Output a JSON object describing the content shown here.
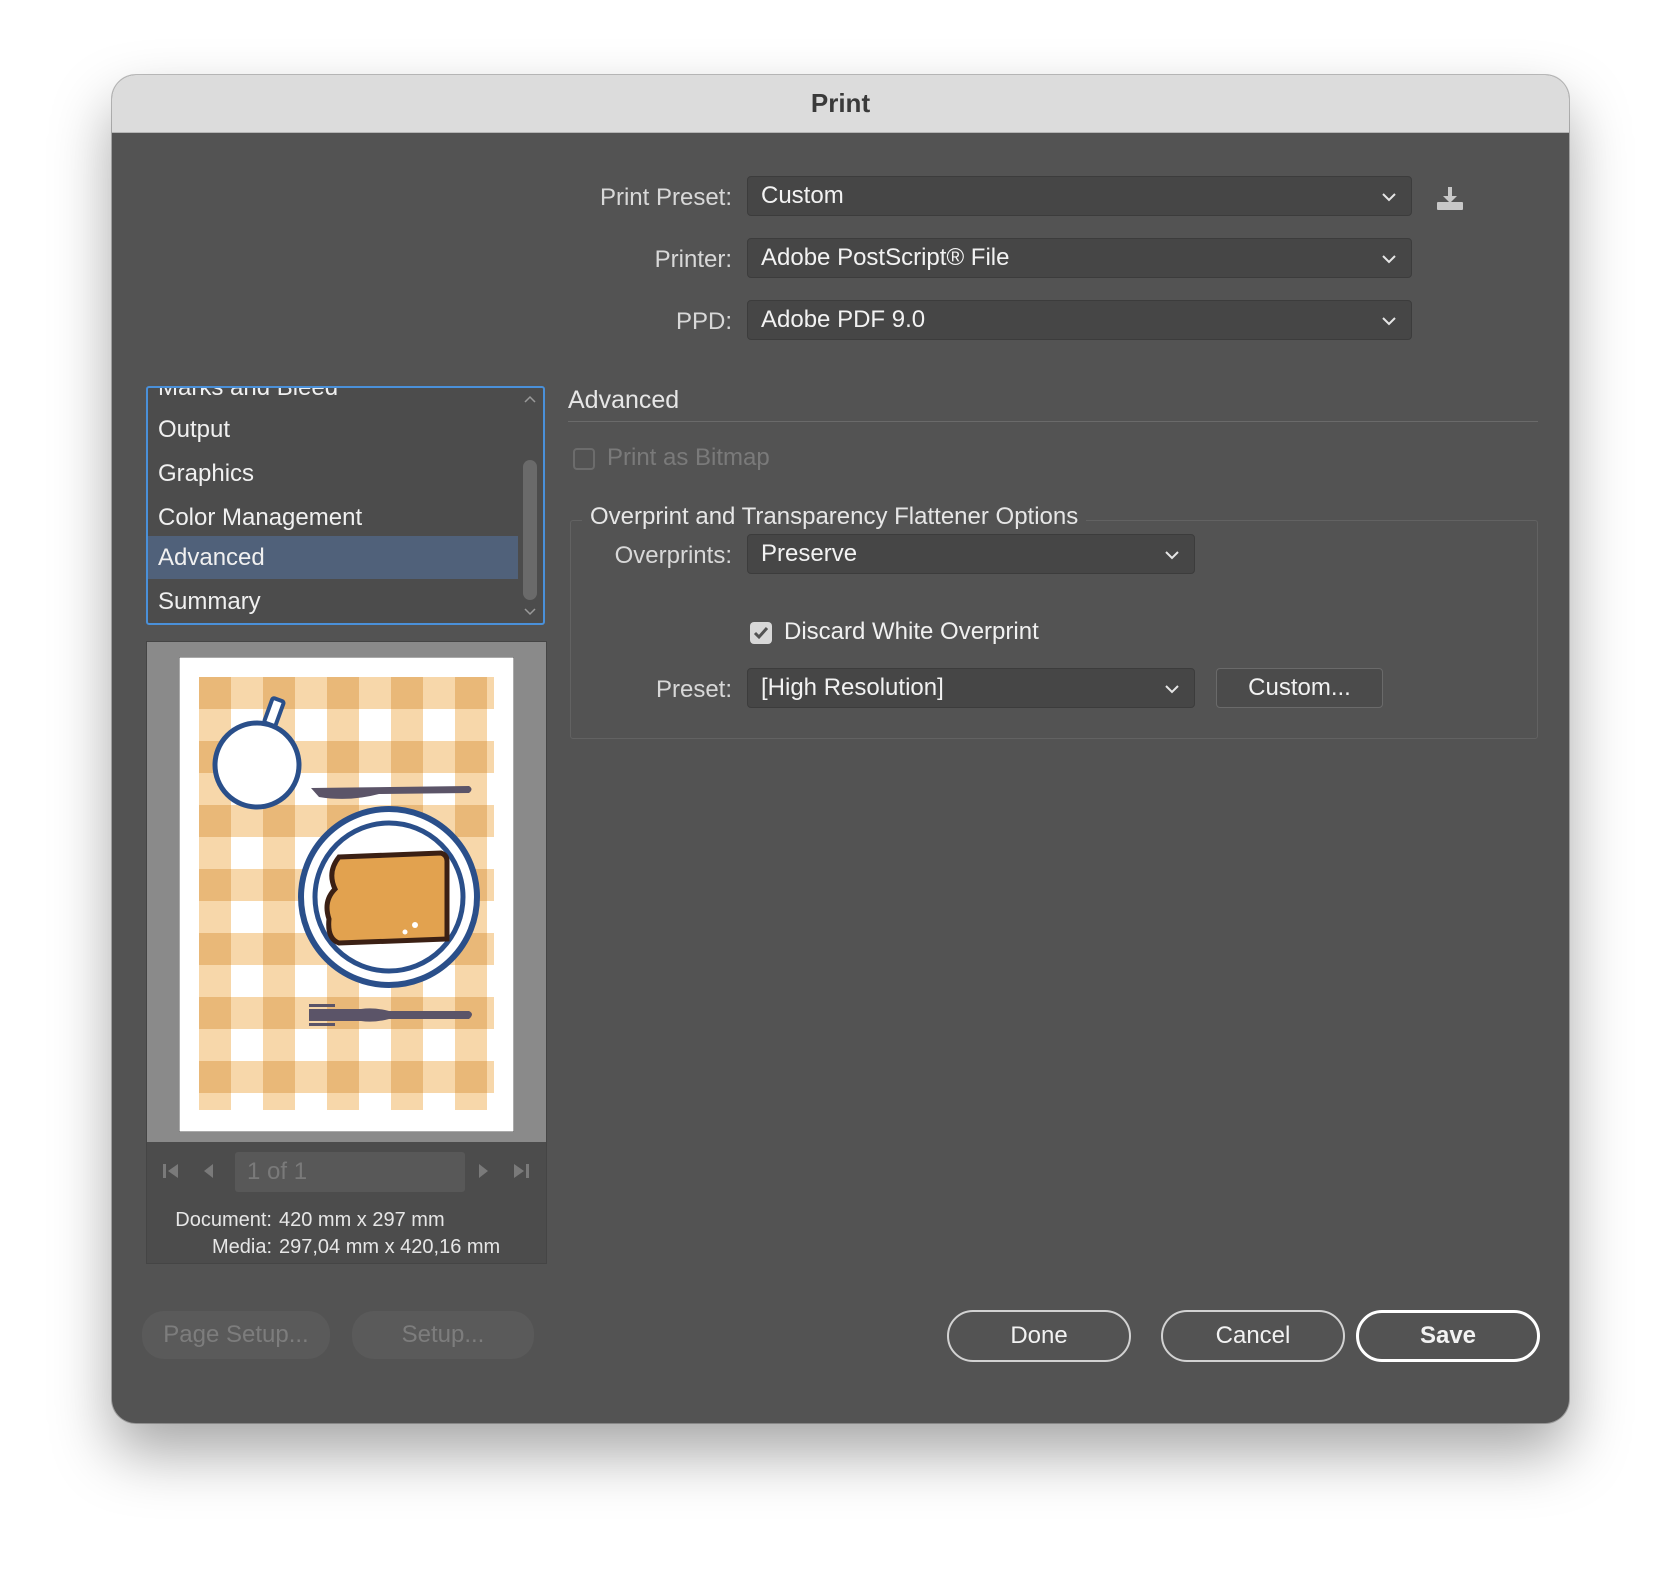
{
  "window": {
    "title": "Print"
  },
  "top_fields": {
    "print_preset": {
      "label": "Print Preset:",
      "value": "Custom"
    },
    "printer": {
      "label": "Printer:",
      "value": "Adobe PostScript® File"
    },
    "ppd": {
      "label": "PPD:",
      "value": "Adobe PDF 9.0"
    }
  },
  "sidebar": {
    "items": [
      {
        "label": "Marks and Bleed"
      },
      {
        "label": "Output"
      },
      {
        "label": "Graphics"
      },
      {
        "label": "Color Management"
      },
      {
        "label": "Advanced"
      },
      {
        "label": "Summary"
      }
    ],
    "selected": "Advanced"
  },
  "preview": {
    "page_indicator": "1 of 1",
    "document_label": "Document:",
    "document_value": "420 mm x 297 mm",
    "media_label": "Media:",
    "media_value": "297,04 mm x 420,16 mm",
    "colors": {
      "check_light": "#f7d7aa",
      "check_dark": "#e9b878",
      "plate": "#2a4f8a",
      "bread": "#e2a24f",
      "utensil": "#5b5468"
    }
  },
  "advanced": {
    "section_title": "Advanced",
    "print_as_bitmap": {
      "label": "Print as Bitmap",
      "checked": false
    },
    "group_title": "Overprint and Transparency Flattener Options",
    "overprints": {
      "label": "Overprints:",
      "value": "Preserve"
    },
    "discard_white_overprint": {
      "label": "Discard White Overprint",
      "checked": true
    },
    "preset": {
      "label": "Preset:",
      "value": "[High Resolution]"
    },
    "custom_button": "Custom..."
  },
  "buttons": {
    "page_setup": "Page Setup...",
    "setup": "Setup...",
    "done": "Done",
    "cancel": "Cancel",
    "save": "Save"
  },
  "theme": {
    "dialog_bg": "#535353",
    "selection": "#50617a",
    "focus": "#4a90d9"
  }
}
